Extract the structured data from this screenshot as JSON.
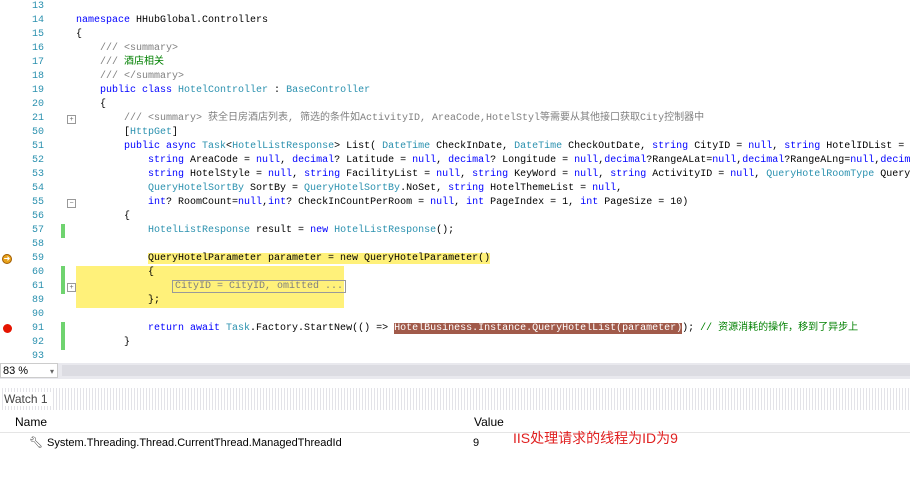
{
  "editor": {
    "lines": [
      {
        "n": "13",
        "t": []
      },
      {
        "n": "14",
        "t": [
          [
            "namespace",
            "kw"
          ],
          [
            " HHubGlobal.Controllers",
            ""
          ]
        ]
      },
      {
        "n": "15",
        "t": [
          [
            "{",
            ""
          ]
        ]
      },
      {
        "n": "16",
        "t": [
          [
            "    ",
            ""
          ],
          [
            "/// <summary>",
            "doc"
          ]
        ]
      },
      {
        "n": "17",
        "t": [
          [
            "    ",
            ""
          ],
          [
            "/// ",
            "doc"
          ],
          [
            "酒店相关",
            "cm"
          ]
        ]
      },
      {
        "n": "18",
        "t": [
          [
            "    ",
            ""
          ],
          [
            "/// </summary>",
            "doc"
          ]
        ]
      },
      {
        "n": "19",
        "t": [
          [
            "    ",
            ""
          ],
          [
            "public class ",
            "kw"
          ],
          [
            "HotelController",
            "ty"
          ],
          [
            " : ",
            ""
          ],
          [
            "BaseController",
            "ty"
          ]
        ]
      },
      {
        "n": "20",
        "t": [
          [
            "    {",
            ""
          ]
        ]
      },
      {
        "n": "21",
        "t": [
          [
            "        ",
            ""
          ],
          [
            "/// <summary> 获全日房酒店列表, 筛选的条件如ActivityID, AreaCode,HotelStyl等需要从其他接口获取City控制器中",
            "doc"
          ]
        ],
        "outline": "+"
      },
      {
        "n": "50",
        "t": [
          [
            "        ",
            ""
          ],
          [
            "[",
            ""
          ],
          [
            "HttpGet",
            "ty"
          ],
          [
            "]",
            ""
          ]
        ]
      },
      {
        "n": "51",
        "t": [
          [
            "        ",
            ""
          ],
          [
            "public async ",
            "kw"
          ],
          [
            "Task",
            "ty"
          ],
          [
            "<",
            ""
          ],
          [
            "HotelListResponse",
            "ty"
          ],
          [
            "> List( ",
            ""
          ],
          [
            "DateTime",
            "ty"
          ],
          [
            " CheckInDate, ",
            ""
          ],
          [
            "DateTime",
            "ty"
          ],
          [
            " CheckOutDate, ",
            ""
          ],
          [
            "string",
            "kw"
          ],
          [
            " CityID = ",
            ""
          ],
          [
            "null",
            "kw"
          ],
          [
            ", ",
            ""
          ],
          [
            "string",
            "kw"
          ],
          [
            " HotelIDList = ",
            ""
          ],
          [
            "null",
            "kw"
          ]
        ]
      },
      {
        "n": "52",
        "t": [
          [
            "            ",
            ""
          ],
          [
            "string",
            "kw"
          ],
          [
            " AreaCode = ",
            ""
          ],
          [
            "null",
            "kw"
          ],
          [
            ", ",
            ""
          ],
          [
            "decimal",
            "kw"
          ],
          [
            "? Latitude = ",
            ""
          ],
          [
            "null",
            "kw"
          ],
          [
            ", ",
            ""
          ],
          [
            "decimal",
            "kw"
          ],
          [
            "? Longitude = ",
            ""
          ],
          [
            "null",
            "kw"
          ],
          [
            ",",
            ""
          ],
          [
            "decimal",
            "kw"
          ],
          [
            "?RangeALat=",
            ""
          ],
          [
            "null",
            "kw"
          ],
          [
            ",",
            ""
          ],
          [
            "decimal",
            "kw"
          ],
          [
            "?RangeALng=",
            ""
          ],
          [
            "null",
            "kw"
          ],
          [
            ",",
            ""
          ],
          [
            "decimal",
            "kw"
          ]
        ]
      },
      {
        "n": "53",
        "t": [
          [
            "            ",
            ""
          ],
          [
            "string",
            "kw"
          ],
          [
            " HotelStyle = ",
            ""
          ],
          [
            "null",
            "kw"
          ],
          [
            ", ",
            ""
          ],
          [
            "string",
            "kw"
          ],
          [
            " FacilityList = ",
            ""
          ],
          [
            "null",
            "kw"
          ],
          [
            ", ",
            ""
          ],
          [
            "string",
            "kw"
          ],
          [
            " KeyWord = ",
            ""
          ],
          [
            "null",
            "kw"
          ],
          [
            ", ",
            ""
          ],
          [
            "string",
            "kw"
          ],
          [
            " ActivityID = ",
            ""
          ],
          [
            "null",
            "kw"
          ],
          [
            ", ",
            ""
          ],
          [
            "QueryHotelRoomType",
            "ty"
          ],
          [
            " QueryRo",
            ""
          ]
        ]
      },
      {
        "n": "54",
        "t": [
          [
            "            ",
            ""
          ],
          [
            "QueryHotelSortBy",
            "ty"
          ],
          [
            " SortBy = ",
            ""
          ],
          [
            "QueryHotelSortBy",
            "ty"
          ],
          [
            ".NoSet, ",
            ""
          ],
          [
            "string",
            "kw"
          ],
          [
            " HotelThemeList = ",
            ""
          ],
          [
            "null",
            "kw"
          ],
          [
            ",",
            ""
          ]
        ]
      },
      {
        "n": "55",
        "t": [
          [
            "            ",
            ""
          ],
          [
            "int",
            "kw"
          ],
          [
            "? RoomCount=",
            ""
          ],
          [
            "null",
            "kw"
          ],
          [
            ",",
            ""
          ],
          [
            "int",
            "kw"
          ],
          [
            "? CheckInCountPerRoom = ",
            ""
          ],
          [
            "null",
            "kw"
          ],
          [
            ", ",
            ""
          ],
          [
            "int",
            "kw"
          ],
          [
            " PageIndex = 1, ",
            ""
          ],
          [
            "int",
            "kw"
          ],
          [
            " PageSize = 10)",
            ""
          ]
        ],
        "outline": "-"
      },
      {
        "n": "56",
        "t": [
          [
            "        {",
            ""
          ]
        ]
      },
      {
        "n": "57",
        "t": [
          [
            "            ",
            ""
          ],
          [
            "HotelListResponse",
            "ty"
          ],
          [
            " result = ",
            ""
          ],
          [
            "new ",
            "kw"
          ],
          [
            "HotelListResponse",
            "ty"
          ],
          [
            "();",
            ""
          ]
        ],
        "chg": true
      },
      {
        "n": "58",
        "t": []
      },
      {
        "n": "59",
        "t": [
          [
            "            ",
            ""
          ],
          [
            "QueryHotelParameter parameter = new QueryHotelParameter()",
            "hl"
          ]
        ],
        "marker": "arrow"
      },
      {
        "n": "60",
        "t": [
          [
            "            ",
            ""
          ],
          [
            "{",
            "hl"
          ]
        ],
        "chg": true,
        "hlrow": true
      },
      {
        "n": "61",
        "t": [
          [
            "                ",
            ""
          ],
          [
            "CityID = CityID, omitted ...",
            "doc"
          ]
        ],
        "chg": true,
        "hlrow": true,
        "outline": "+"
      },
      {
        "n": "89",
        "t": [
          [
            "            ",
            ""
          ],
          [
            "};",
            "hl"
          ]
        ],
        "hlrow": true
      },
      {
        "n": "90",
        "t": []
      },
      {
        "n": "91",
        "t": [
          [
            "            ",
            ""
          ],
          [
            "return await ",
            "kw"
          ],
          [
            "Task",
            "ty"
          ],
          [
            ".Factory.StartNew(() => ",
            ""
          ],
          [
            "HotelBusiness.Instance.QueryHotelList(parameter)",
            "sel"
          ],
          [
            "); ",
            ""
          ],
          [
            "// 资源消耗的操作，移到了异步上",
            "cm"
          ]
        ],
        "chg": true,
        "marker": "breakpoint"
      },
      {
        "n": "92",
        "t": [
          [
            "        }",
            ""
          ]
        ],
        "chg": true
      },
      {
        "n": "93",
        "t": []
      }
    ]
  },
  "zoom": {
    "level": "83 %"
  },
  "watch": {
    "title": "Watch 1",
    "col_name": "Name",
    "col_value": "Value",
    "rows": [
      {
        "name": "System.Threading.Thread.CurrentThread.ManagedThreadId",
        "value": "9",
        "icon": "wrench-icon"
      }
    ]
  },
  "annotation": {
    "text": "IIS处理请求的线程为ID为9",
    "color": "#e02020"
  }
}
